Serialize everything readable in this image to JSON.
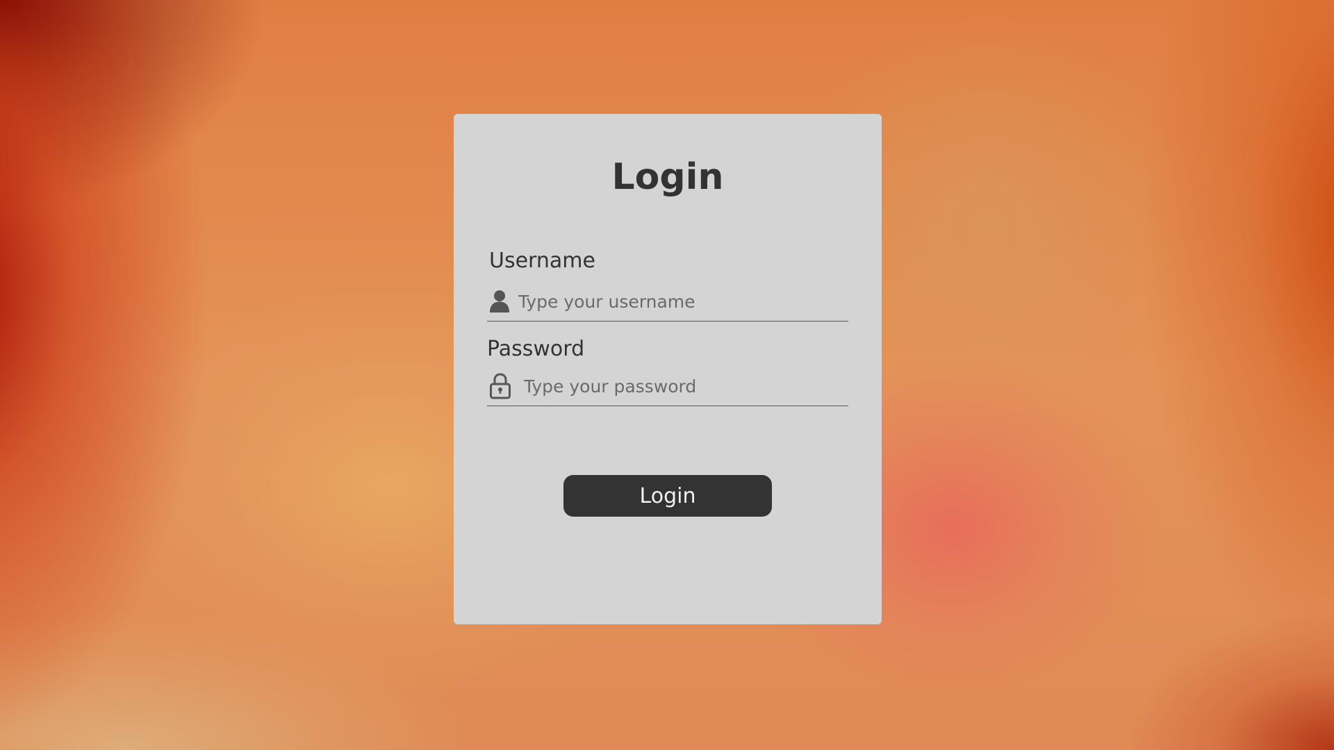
{
  "background": {
    "colors": [
      "#8b0a0a",
      "#e05a10",
      "#e6a55c",
      "#e87060",
      "#cc4a10"
    ]
  },
  "login_form": {
    "title": "Login",
    "username": {
      "label": "Username",
      "placeholder": "Type your username",
      "value": "",
      "icon": "user-icon"
    },
    "password": {
      "label": "Password",
      "placeholder": "Type your password",
      "value": "",
      "icon": "lock-icon"
    },
    "submit_label": "Login"
  },
  "colors": {
    "card_background": "#d4d4d4",
    "text": "#333333",
    "button_background": "#333333",
    "button_text": "#f2f2f2"
  }
}
